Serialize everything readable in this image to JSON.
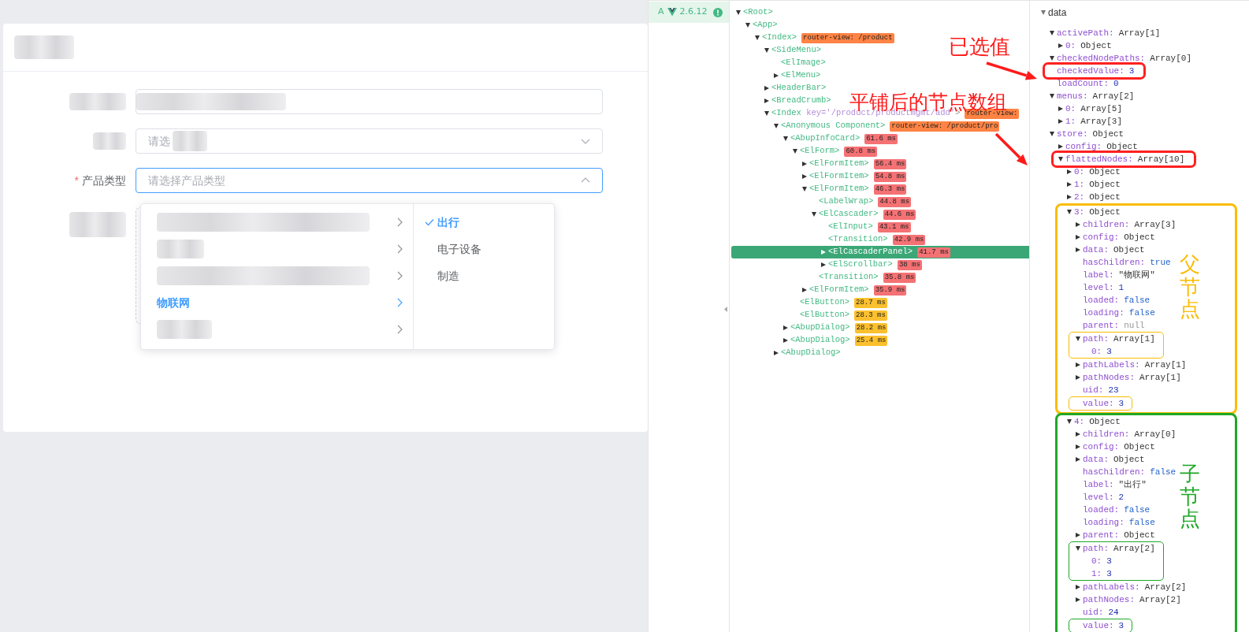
{
  "form": {
    "fields": [
      {
        "kind": "text"
      },
      {
        "kind": "select",
        "placeholder": "请选",
        "open": false
      },
      {
        "kind": "cascader",
        "required_mark": "*",
        "label": "产品类型",
        "placeholder": "请选择产品类型",
        "open": true
      },
      {
        "kind": "upload"
      }
    ],
    "cascader_menu": {
      "columns": [
        {
          "items": [
            {
              "kind": "branch",
              "redacted": true,
              "selected": false
            },
            {
              "kind": "branch",
              "redacted": true,
              "selected": false
            },
            {
              "kind": "branch",
              "redacted": true,
              "selected": false
            },
            {
              "kind": "branch",
              "label": "物联网",
              "selected": true
            },
            {
              "kind": "branch",
              "redacted": true,
              "selected": false
            }
          ]
        },
        {
          "items": [
            {
              "kind": "leaf",
              "label": "出行",
              "selected": true
            },
            {
              "kind": "leaf",
              "label": "电子设备",
              "selected": false
            },
            {
              "kind": "leaf",
              "label": "制造",
              "selected": false
            }
          ]
        }
      ]
    }
  },
  "devtools": {
    "version": {
      "prefix": "A",
      "number": "2.6.12"
    },
    "component_tree": [
      {
        "tag": "<Root>",
        "expanded": true,
        "selected": false,
        "children": [
          {
            "tag": "<App>",
            "expanded": true,
            "selected": false,
            "children": [
              {
                "tag": "<Index>",
                "badge": {
                  "text": "router-view: /product",
                  "kind": "route"
                },
                "expanded": true,
                "selected": false,
                "children": [
                  {
                    "tag": "<SideMenu>",
                    "expanded": true,
                    "selected": false,
                    "children": [
                      {
                        "tag": "<ElImage>",
                        "selected": false
                      },
                      {
                        "tag": "<ElMenu>",
                        "expanded": false,
                        "selected": false
                      }
                    ]
                  },
                  {
                    "tag": "<HeaderBar>",
                    "expanded": false,
                    "selected": false
                  },
                  {
                    "tag": "<BreadCrumb>",
                    "expanded": false,
                    "selected": false
                  },
                  {
                    "tag": "<Index",
                    "attr": "key='/product/productmgmt/add'",
                    "tag_end": ">",
                    "badge": {
                      "text": "router-view:",
                      "kind": "route"
                    },
                    "expanded": true,
                    "selected": false,
                    "children": [
                      {
                        "tag": "<Anonymous Component>",
                        "badge": {
                          "text": "router-view: /product/pro",
                          "kind": "route"
                        },
                        "expanded": true,
                        "selected": false,
                        "children": [
                          {
                            "tag": "<AbupInfoCard>",
                            "badge": {
                              "text": "61.6 ms",
                              "kind": "slow"
                            },
                            "expanded": true,
                            "selected": false,
                            "children": [
                              {
                                "tag": "<ElForm>",
                                "badge": {
                                  "text": "60.8 ms",
                                  "kind": "slow"
                                },
                                "expanded": true,
                                "selected": false,
                                "children": [
                                  {
                                    "tag": "<ElFormItem>",
                                    "badge": {
                                      "text": "56.4 ms",
                                      "kind": "slow"
                                    },
                                    "expanded": false,
                                    "selected": false
                                  },
                                  {
                                    "tag": "<ElFormItem>",
                                    "badge": {
                                      "text": "54.8 ms",
                                      "kind": "slow"
                                    },
                                    "expanded": false,
                                    "selected": false
                                  },
                                  {
                                    "tag": "<ElFormItem>",
                                    "badge": {
                                      "text": "46.3 ms",
                                      "kind": "slow"
                                    },
                                    "expanded": true,
                                    "selected": false,
                                    "children": [
                                      {
                                        "tag": "<LabelWrap>",
                                        "badge": {
                                          "text": "44.8 ms",
                                          "kind": "slow"
                                        },
                                        "selected": false
                                      },
                                      {
                                        "tag": "<ElCascader>",
                                        "badge": {
                                          "text": "44.6 ms",
                                          "kind": "slow"
                                        },
                                        "expanded": true,
                                        "selected": false,
                                        "children": [
                                          {
                                            "tag": "<ElInput>",
                                            "badge": {
                                              "text": "43.1 ms",
                                              "kind": "slow"
                                            },
                                            "selected": false
                                          },
                                          {
                                            "tag": "<Transition>",
                                            "badge": {
                                              "text": "42.9 ms",
                                              "kind": "slow"
                                            },
                                            "selected": false
                                          },
                                          {
                                            "tag": "<ElCascaderPanel>",
                                            "badge": {
                                              "text": "41.7 ms",
                                              "kind": "slow"
                                            },
                                            "expanded": false,
                                            "selected": true
                                          },
                                          {
                                            "tag": "<ElScrollbar>",
                                            "badge": {
                                              "text": "38 ms",
                                              "kind": "slow"
                                            },
                                            "expanded": false,
                                            "selected": false
                                          }
                                        ]
                                      },
                                      {
                                        "tag": "<Transition>",
                                        "badge": {
                                          "text": "35.8 ms",
                                          "kind": "slow"
                                        },
                                        "selected": false
                                      }
                                    ]
                                  },
                                  {
                                    "tag": "<ElFormItem>",
                                    "badge": {
                                      "text": "35.9 ms",
                                      "kind": "slow"
                                    },
                                    "expanded": false,
                                    "selected": false
                                  }
                                ]
                              },
                              {
                                "tag": "<ElButton>",
                                "badge": {
                                  "text": "28.7 ms",
                                  "kind": "medium"
                                },
                                "selected": false
                              },
                              {
                                "tag": "<ElButton>",
                                "badge": {
                                  "text": "28.3 ms",
                                  "kind": "medium"
                                },
                                "selected": false
                              }
                            ]
                          },
                          {
                            "tag": "<AbupDialog>",
                            "badge": {
                              "text": "28.2 ms",
                              "kind": "medium"
                            },
                            "expanded": false,
                            "selected": false
                          },
                          {
                            "tag": "<AbupDialog>",
                            "badge": {
                              "text": "25.4 ms",
                              "kind": "medium"
                            },
                            "expanded": false,
                            "selected": false
                          }
                        ]
                      },
                      {
                        "tag": "<AbupDialog>",
                        "expanded": false,
                        "selected": false
                      }
                    ]
                  }
                ]
              }
            ]
          }
        ]
      }
    ],
    "state": {
      "title": "data",
      "expanded": true,
      "items": [
        {
          "key": "activePath:",
          "value": "Array[1]",
          "kind": "object",
          "expanded": true,
          "children": [
            {
              "key": "0:",
              "value": "Object",
              "kind": "object",
              "expanded": false
            }
          ]
        },
        {
          "key": "checkedNodePaths:",
          "value": "Array[0]",
          "kind": "object",
          "expanded": true
        },
        {
          "key": "checkedValue:",
          "value": "3",
          "kind": "number",
          "frame": {
            "kind": "bold",
            "color": "#ff2020"
          }
        },
        {
          "key": "loadCount:",
          "value": "0",
          "kind": "number"
        },
        {
          "key": "menus:",
          "value": "Array[2]",
          "kind": "object",
          "expanded": true,
          "children": [
            {
              "key": "0:",
              "value": "Array[5]",
              "kind": "object",
              "expanded": false
            },
            {
              "key": "1:",
              "value": "Array[3]",
              "kind": "object",
              "expanded": false
            }
          ]
        },
        {
          "key": "store:",
          "value": "Object",
          "kind": "object",
          "expanded": true,
          "children": [
            {
              "key": "config:",
              "value": "Object",
              "kind": "object",
              "expanded": false
            },
            {
              "key": "flattedNodes:",
              "value": "Array[10]",
              "kind": "object",
              "expanded": true,
              "frame": {
                "kind": "bold",
                "color": "#ff2020"
              },
              "children": [
                {
                  "key": "0:",
                  "value": "Object",
                  "kind": "object",
                  "expanded": false
                },
                {
                  "key": "1:",
                  "value": "Object",
                  "kind": "object",
                  "expanded": false
                },
                {
                  "key": "2:",
                  "value": "Object",
                  "kind": "object",
                  "expanded": false
                },
                {
                  "key": "3:",
                  "value": "Object",
                  "kind": "object",
                  "expanded": true,
                  "frame": {
                    "kind": "region",
                    "color": "#fbbc05",
                    "note": "父节点"
                  },
                  "children": [
                    {
                      "key": "children:",
                      "value": "Array[3]",
                      "kind": "object",
                      "expanded": false
                    },
                    {
                      "key": "config:",
                      "value": "Object",
                      "kind": "object",
                      "expanded": false
                    },
                    {
                      "key": "data:",
                      "value": "Object",
                      "kind": "object",
                      "expanded": false
                    },
                    {
                      "key": "hasChildren:",
                      "value": "true",
                      "kind": "boolean"
                    },
                    {
                      "key": "label:",
                      "value": "\"物联网\"",
                      "kind": "string"
                    },
                    {
                      "key": "level:",
                      "value": "1",
                      "kind": "number"
                    },
                    {
                      "key": "loaded:",
                      "value": "false",
                      "kind": "boolean"
                    },
                    {
                      "key": "loading:",
                      "value": "false",
                      "kind": "boolean"
                    },
                    {
                      "key": "parent:",
                      "value": "null",
                      "kind": "null"
                    },
                    {
                      "key": "path:",
                      "value": "Array[1]",
                      "kind": "object",
                      "expanded": true,
                      "frame": {
                        "kind": "thin",
                        "color": "#fbbc05"
                      },
                      "children": [
                        {
                          "key": "0:",
                          "value": "3",
                          "kind": "number"
                        }
                      ]
                    },
                    {
                      "key": "pathLabels:",
                      "value": "Array[1]",
                      "kind": "object",
                      "expanded": false
                    },
                    {
                      "key": "pathNodes:",
                      "value": "Array[1]",
                      "kind": "object",
                      "expanded": false
                    },
                    {
                      "key": "uid:",
                      "value": "23",
                      "kind": "number"
                    },
                    {
                      "key": "value:",
                      "value": "3",
                      "kind": "number",
                      "frame": {
                        "kind": "thin",
                        "color": "#fbbc05"
                      }
                    }
                  ]
                },
                {
                  "key": "4:",
                  "value": "Object",
                  "kind": "object",
                  "expanded": true,
                  "frame": {
                    "kind": "region",
                    "color": "#1fa826",
                    "note": "子节点"
                  },
                  "children": [
                    {
                      "key": "children:",
                      "value": "Array[0]",
                      "kind": "object",
                      "expanded": false
                    },
                    {
                      "key": "config:",
                      "value": "Object",
                      "kind": "object",
                      "expanded": false
                    },
                    {
                      "key": "data:",
                      "value": "Object",
                      "kind": "object",
                      "expanded": false
                    },
                    {
                      "key": "hasChildren:",
                      "value": "false",
                      "kind": "boolean"
                    },
                    {
                      "key": "label:",
                      "value": "\"出行\"",
                      "kind": "string"
                    },
                    {
                      "key": "level:",
                      "value": "2",
                      "kind": "number"
                    },
                    {
                      "key": "loaded:",
                      "value": "false",
                      "kind": "boolean"
                    },
                    {
                      "key": "loading:",
                      "value": "false",
                      "kind": "boolean"
                    },
                    {
                      "key": "parent:",
                      "value": "Object",
                      "kind": "object",
                      "expanded": false
                    },
                    {
                      "key": "path:",
                      "value": "Array[2]",
                      "kind": "object",
                      "expanded": true,
                      "frame": {
                        "kind": "thin",
                        "color": "#1fa826"
                      },
                      "children": [
                        {
                          "key": "0:",
                          "value": "3",
                          "kind": "number"
                        },
                        {
                          "key": "1:",
                          "value": "3",
                          "kind": "number"
                        }
                      ]
                    },
                    {
                      "key": "pathLabels:",
                      "value": "Array[2]",
                      "kind": "object",
                      "expanded": false
                    },
                    {
                      "key": "pathNodes:",
                      "value": "Array[2]",
                      "kind": "object",
                      "expanded": false
                    },
                    {
                      "key": "uid:",
                      "value": "24",
                      "kind": "number"
                    },
                    {
                      "key": "value:",
                      "value": "3",
                      "kind": "number",
                      "frame": {
                        "kind": "thin",
                        "color": "#1fa826"
                      }
                    }
                  ]
                }
              ]
            }
          ]
        }
      ]
    }
  },
  "annotations": [
    {
      "text": "已选值",
      "color": "#ff1a1a"
    },
    {
      "text": "平铺后的节点数组",
      "color": "#ff1a1a"
    }
  ]
}
